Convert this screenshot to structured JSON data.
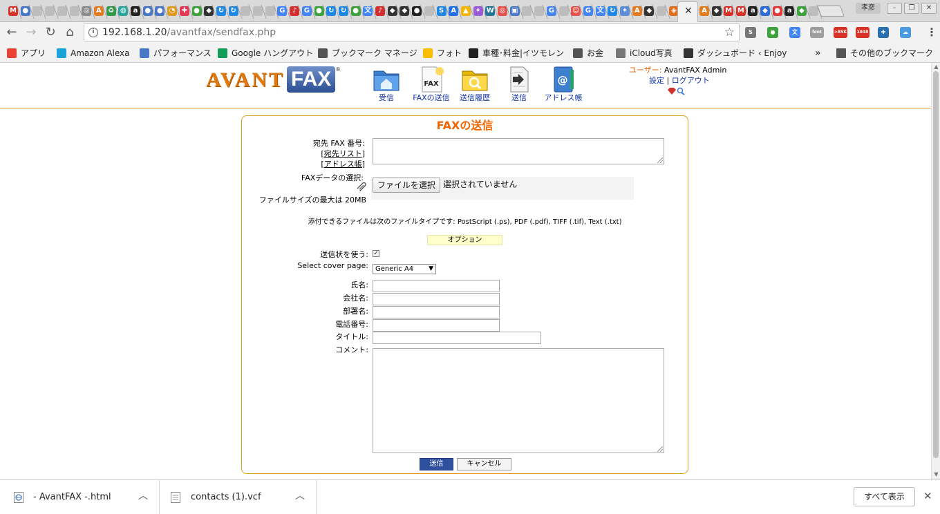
{
  "browser": {
    "tab_favicons": [
      {
        "icon": "gmail-icon",
        "glyph": "M",
        "color": "#d93025"
      },
      {
        "icon": "account-icon",
        "glyph": "●",
        "color": "#4a78c8"
      },
      {
        "icon": "page-icon",
        "glyph": "",
        "color": "#bdbdbd"
      },
      {
        "icon": "page-icon",
        "glyph": "",
        "color": "#bdbdbd"
      },
      {
        "icon": "page-icon",
        "glyph": "",
        "color": "#bdbdbd"
      },
      {
        "icon": "page-icon",
        "glyph": "",
        "color": "#bdbdbd"
      },
      {
        "icon": "chrome-icon",
        "glyph": "◎",
        "color": "#8a8a8a"
      },
      {
        "icon": "avantfax-icon",
        "glyph": "A",
        "color": "#e57c1f"
      },
      {
        "icon": "recycle-icon",
        "glyph": "♻",
        "color": "#2e9a4a"
      },
      {
        "icon": "globe-icon",
        "glyph": "◍",
        "color": "#2aa5a0"
      },
      {
        "icon": "amazon-icon",
        "glyph": "a",
        "color": "#222222"
      },
      {
        "icon": "account-icon",
        "glyph": "●",
        "color": "#4a78c8"
      },
      {
        "icon": "account-icon",
        "glyph": "●",
        "color": "#4a78c8"
      },
      {
        "icon": "clock-icon",
        "glyph": "◔",
        "color": "#e09a20"
      },
      {
        "icon": "app-icon",
        "glyph": "✚",
        "color": "#e03a55"
      },
      {
        "icon": "evernote-icon",
        "glyph": "●",
        "color": "#3ea33e"
      },
      {
        "icon": "ninja-icon",
        "glyph": "◆",
        "color": "#333333"
      },
      {
        "icon": "sync-icon",
        "glyph": "↻",
        "color": "#1e88e5"
      },
      {
        "icon": "sync-icon",
        "glyph": "↻",
        "color": "#1e88e5"
      },
      {
        "icon": "page-icon",
        "glyph": "",
        "color": "#bdbdbd"
      },
      {
        "icon": "page-icon",
        "glyph": "",
        "color": "#bdbdbd"
      },
      {
        "icon": "page-icon",
        "glyph": "",
        "color": "#bdbdbd"
      },
      {
        "icon": "google-icon",
        "glyph": "G",
        "color": "#4285f4"
      },
      {
        "icon": "music-icon",
        "glyph": "♪",
        "color": "#d32f2f"
      },
      {
        "icon": "google-icon",
        "glyph": "G",
        "color": "#4285f4"
      },
      {
        "icon": "evernote-icon",
        "glyph": "●",
        "color": "#3ea33e"
      },
      {
        "icon": "sync-icon",
        "glyph": "↻",
        "color": "#1e88e5"
      },
      {
        "icon": "sync-icon",
        "glyph": "↻",
        "color": "#1e88e5"
      },
      {
        "icon": "evernote-icon",
        "glyph": "●",
        "color": "#3ea33e"
      },
      {
        "icon": "translate-icon",
        "glyph": "文",
        "color": "#4285f4"
      },
      {
        "icon": "music-icon",
        "glyph": "♪",
        "color": "#d32f2f"
      },
      {
        "icon": "ninja-icon",
        "glyph": "◆",
        "color": "#333333"
      },
      {
        "icon": "ninja-icon",
        "glyph": "◆",
        "color": "#333333"
      },
      {
        "icon": "github-icon",
        "glyph": "●",
        "color": "#222222"
      },
      {
        "icon": "page-icon",
        "glyph": "",
        "color": "#bdbdbd"
      },
      {
        "icon": "sync-icon",
        "glyph": "S",
        "color": "#1e88e5"
      },
      {
        "icon": "atlassian-icon",
        "glyph": "A",
        "color": "#1f6feb"
      },
      {
        "icon": "drive-icon",
        "glyph": "▲",
        "color": "#f4b400"
      },
      {
        "icon": "app-icon",
        "glyph": "✦",
        "color": "#9c5bd9"
      },
      {
        "icon": "wordpress-icon",
        "glyph": "W",
        "color": "#21759b"
      },
      {
        "icon": "app-icon",
        "glyph": "◎",
        "color": "#e5534b"
      },
      {
        "icon": "page-icon",
        "glyph": "▣",
        "color": "#4a78c8"
      },
      {
        "icon": "page-icon",
        "glyph": "",
        "color": "#bdbdbd"
      },
      {
        "icon": "page-icon",
        "glyph": "",
        "color": "#bdbdbd"
      },
      {
        "icon": "google-icon",
        "glyph": "G",
        "color": "#4285f4"
      },
      {
        "icon": "page-icon",
        "glyph": "",
        "color": "#bdbdbd"
      },
      {
        "icon": "app-icon",
        "glyph": "☺",
        "color": "#e5534b"
      },
      {
        "icon": "google-icon",
        "glyph": "G",
        "color": "#4285f4"
      },
      {
        "icon": "translate-icon",
        "glyph": "文",
        "color": "#4285f4"
      },
      {
        "icon": "sync-icon",
        "glyph": "↻",
        "color": "#1e88e5"
      },
      {
        "icon": "app-icon",
        "glyph": "✦",
        "color": "#5b8fd9"
      },
      {
        "icon": "avantfax-icon",
        "glyph": "A",
        "color": "#e57c1f"
      },
      {
        "icon": "ninja-icon",
        "glyph": "◆",
        "color": "#333333"
      },
      {
        "icon": "page-icon",
        "glyph": "",
        "color": "#bdbdbd"
      },
      {
        "icon": "clock-icon",
        "glyph": "◈",
        "color": "#e0701f"
      }
    ],
    "tab_favicons_after_active": [
      {
        "icon": "avantfax-icon",
        "glyph": "A",
        "color": "#e57c1f"
      },
      {
        "icon": "ninja-icon",
        "glyph": "◆",
        "color": "#333333"
      },
      {
        "icon": "gmail-icon",
        "glyph": "M",
        "color": "#d93025"
      },
      {
        "icon": "gmail-icon",
        "glyph": "M",
        "color": "#d93025"
      },
      {
        "icon": "amazon-icon",
        "glyph": "a",
        "color": "#222222"
      },
      {
        "icon": "app-icon",
        "glyph": "◆",
        "color": "#2f6bd9"
      },
      {
        "icon": "app-icon",
        "glyph": "●",
        "color": "#e03a3a"
      },
      {
        "icon": "amazon-icon",
        "glyph": "a",
        "color": "#222222"
      },
      {
        "icon": "app-icon",
        "glyph": "◆",
        "color": "#3ea33e"
      },
      {
        "icon": "page-icon",
        "glyph": "",
        "color": "#bdbdbd"
      }
    ],
    "profile_label": "孝彦",
    "address": {
      "host": "192.168.1.20",
      "path": "/avantfax/sendfax.php"
    },
    "extensions": [
      {
        "icon": "s-icon",
        "glyph": "S",
        "color": "#777777"
      },
      {
        "icon": "evernote-icon",
        "glyph": "●",
        "color": "#3ea33e"
      },
      {
        "icon": "translate-icon",
        "glyph": "文",
        "color": "#4285f4"
      },
      {
        "icon": "font-icon",
        "glyph": "font",
        "color": "#9e9e9e"
      },
      {
        "icon": "gmail-icon",
        "glyph": ">85K",
        "color": "#d93025"
      },
      {
        "icon": "gmail-icon",
        "glyph": "1848",
        "color": "#d93025"
      },
      {
        "icon": "app-icon",
        "glyph": "✚",
        "color": "#2a6fb0"
      },
      {
        "icon": "cloud-icon",
        "glyph": "☁",
        "color": "#4a9be0"
      }
    ],
    "bookmarks": [
      {
        "icon": "apps-icon",
        "label": "アプリ",
        "color": "#e94235"
      },
      {
        "icon": "map-pin-icon",
        "label": "Amazon Alexa",
        "color": "#1aa3d9"
      },
      {
        "icon": "performance-icon",
        "label": "パフォーマンス",
        "color": "#4a78c8"
      },
      {
        "icon": "hangouts-icon",
        "label": "Google ハングアウト",
        "color": "#0f9d58"
      },
      {
        "icon": "star-icon",
        "label": "ブックマーク マネージ",
        "color": "#555555"
      },
      {
        "icon": "photos-icon",
        "label": "フォト",
        "color": "#fbbc04"
      },
      {
        "icon": "itsumo-icon",
        "label": "車種･料金|イツモレン",
        "color": "#222222"
      },
      {
        "icon": "folder-icon",
        "label": "お金",
        "color": "#555555"
      },
      {
        "icon": "apple-icon",
        "label": "iCloud写真",
        "color": "#777777"
      },
      {
        "icon": "dashboard-icon",
        "label": "ダッシュボード ‹ Enjoy",
        "color": "#333333"
      }
    ],
    "bookmarks_overflow": "»",
    "other_bookmarks": "その他のブックマーク"
  },
  "app": {
    "logo": {
      "part1": "AVANT",
      "part2": "FAX",
      "mark": "®"
    },
    "nav": [
      {
        "label": "受信",
        "icon": "inbox-folder-icon"
      },
      {
        "label": "FAXの送信",
        "icon": "send-fax-icon"
      },
      {
        "label": "送信履歴",
        "icon": "sent-history-icon"
      },
      {
        "label": "送信",
        "icon": "outbox-icon"
      },
      {
        "label": "アドレス帳",
        "icon": "address-book-icon"
      }
    ],
    "user": {
      "label": "ユーザー:",
      "name": "AvantFAX Admin",
      "settings": "設定",
      "separator": "|",
      "logout": "ログアウト"
    }
  },
  "form": {
    "title": "FAXの送信",
    "dest_label": "宛先 FAX 番号:",
    "dest_list_link": "宛先リスト",
    "address_book_link": "アドレス帳",
    "dest_value": "",
    "file_label": "FAXデータの選択:",
    "file_button": "ファイルを選択",
    "file_status": "選択されていません",
    "max_size": "ファイルサイズの最大は 20MB",
    "filetypes": "添付できるファイルは次のファイルタイプです: PostScript (.ps), PDF (.pdf), TIFF (.tif), Text (.txt)",
    "options": "オプション",
    "use_cover_label": "送信状を使う:",
    "use_cover_checked": true,
    "select_cover_label": "Select cover page:",
    "cover_value": "Generic A4",
    "name_label": "氏名:",
    "company_label": "会社名:",
    "dept_label": "部署名:",
    "phone_label": "電話番号:",
    "subject_label": "タイトル:",
    "comment_label": "コメント:",
    "send": "送信",
    "cancel": "キャンセル"
  },
  "downloads": {
    "items": [
      {
        "name": "- AvantFAX -.html",
        "icon": "html-file-icon"
      },
      {
        "name": "contacts (1).vcf",
        "icon": "vcf-file-icon"
      }
    ],
    "show_all": "すべて表示"
  }
}
